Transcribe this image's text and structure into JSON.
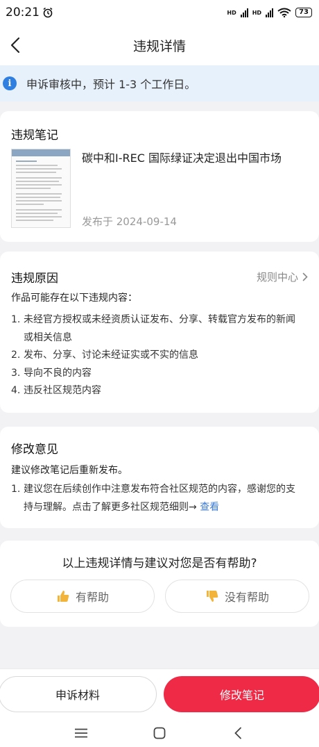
{
  "status_bar": {
    "time": "20:21",
    "signal1": "HD",
    "signal2": "HD",
    "battery": "73"
  },
  "header": {
    "title": "违规详情"
  },
  "notice": {
    "text": "申诉审核中，预计 1-3 个工作日。"
  },
  "note_card": {
    "title": "违规笔记",
    "note_title": "碳中和I-REC 国际绿证决定退出中国市场",
    "date": "发布于 2024-09-14"
  },
  "reason_card": {
    "title": "违规原因",
    "rule_center": "规则中心",
    "intro": "作品可能存在以下违规内容：",
    "items": [
      {
        "num": "1.",
        "text": "未经官方授权或未经资质认证发布、分享、转载官方发布的新闻或相关信息"
      },
      {
        "num": "2.",
        "text": "发布、分享、讨论未经证实或不实的信息"
      },
      {
        "num": "3.",
        "text": "导向不良的内容"
      },
      {
        "num": "4.",
        "text": "违反社区规范内容"
      }
    ]
  },
  "advice_card": {
    "title": "修改意见",
    "intro": "建议修改笔记后重新发布。",
    "item_num": "1.",
    "item_text": "建议您在后续创作中注意发布符合社区规范的内容，感谢您的支持与理解。点击了解更多社区规范细则→ ",
    "link": "查看"
  },
  "feedback": {
    "question": "以上违规详情与建议对您是否有帮助?",
    "yes": "有帮助",
    "no": "没有帮助"
  },
  "actions": {
    "appeal": "申诉材料",
    "edit": "修改笔记"
  },
  "colors": {
    "accent": "#ee2a47",
    "info_blue": "#2f7fe0",
    "notice_bg": "#e7f1fb",
    "link": "#3a7bd5"
  },
  "icons": {
    "back": "chevron-left-icon",
    "info": "info-icon",
    "rule_arrow": "chevron-right-icon",
    "thumb_up": "thumbs-up-icon",
    "thumb_down": "thumbs-down-icon"
  }
}
